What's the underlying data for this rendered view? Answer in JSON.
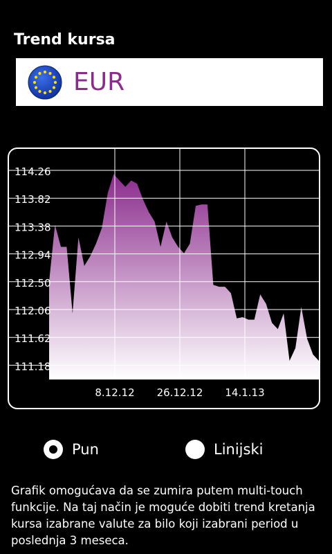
{
  "page": {
    "title": "Trend kursa",
    "currency": {
      "code": "EUR",
      "icon": "eu-flag-icon",
      "color": "#8b2c8d"
    }
  },
  "options": {
    "pun_label": "Pun",
    "linijski_label": "Linijski",
    "selected": "Pun"
  },
  "note": "Grafik omogućava da se zumira putem multi-touch funkcije. Na taj način je moguće dobiti trend kretanja kursa izabrane valute za bilo koji izabrani period u poslednja 3 meseca.",
  "chart_data": {
    "type": "area",
    "title": "",
    "xlabel": "",
    "ylabel": "",
    "y_ticks": [
      "114.26",
      "113.82",
      "113.38",
      "112.94",
      "112.50",
      "112.06",
      "111.62",
      "111.18"
    ],
    "x_ticks": [
      "8.12.12",
      "26.12.12",
      "14.1.13"
    ],
    "ylim": [
      110.98,
      114.4
    ],
    "grid": true,
    "fill_colors": [
      "#8b2c8d",
      "#ffffff"
    ],
    "series": [
      {
        "values": [
          112.5,
          113.4,
          113.05,
          113.05,
          112.0,
          113.2,
          112.75,
          112.9,
          113.1,
          113.35,
          113.9,
          114.2,
          114.1,
          114.0,
          114.1,
          114.05,
          113.8,
          113.6,
          113.45,
          113.05,
          113.45,
          113.2,
          113.05,
          112.95,
          113.1,
          113.7,
          113.72,
          113.72,
          112.45,
          112.42,
          112.42,
          112.32,
          111.92,
          111.94,
          111.9,
          111.9,
          112.3,
          112.15,
          111.85,
          111.75,
          112.0,
          111.25,
          111.45,
          112.1,
          111.6,
          111.35,
          111.25
        ]
      }
    ]
  }
}
